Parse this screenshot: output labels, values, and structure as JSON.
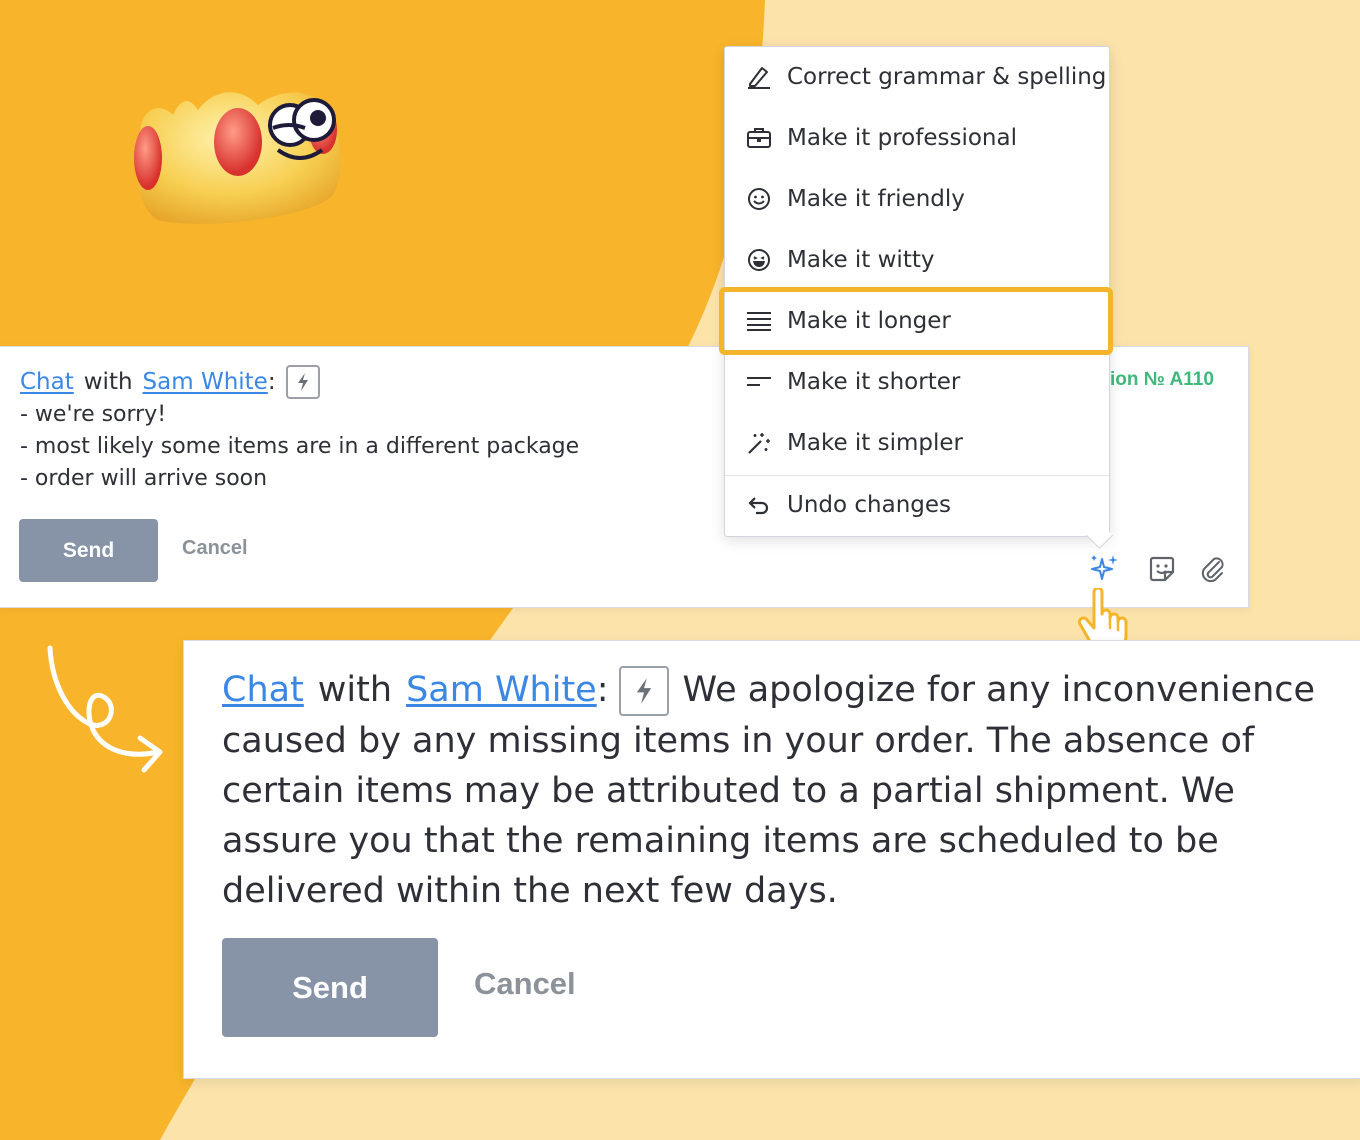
{
  "colors": {
    "background_light": "#fbe3aa",
    "background_orange": "#f8b52b",
    "link": "#3b87e6",
    "send_button": "#8794a8",
    "highlight": "#f5b52a",
    "order_ref": "#3fb97b"
  },
  "small_composer": {
    "chat_link": "Chat",
    "with_text": "with",
    "contact_link": "Sam White",
    "colon": ":",
    "lines": [
      "- we're sorry!",
      "- most likely some items are in a different package",
      "- order will arrive soon"
    ],
    "send_label": "Send",
    "cancel_label": "Cancel",
    "order_ref": "ion № A110",
    "toolbar_icons": [
      "sparkle-icon",
      "sticker-icon",
      "paperclip-icon"
    ]
  },
  "menu": {
    "items": [
      {
        "label": "Correct grammar & spelling",
        "icon": "pencil-icon"
      },
      {
        "label": "Make it professional",
        "icon": "briefcase-icon"
      },
      {
        "label": "Make it friendly",
        "icon": "smile-icon"
      },
      {
        "label": "Make it witty",
        "icon": "grin-icon"
      },
      {
        "label": "Make it longer",
        "icon": "lines-long-icon",
        "selected": true
      },
      {
        "label": "Make it shorter",
        "icon": "lines-short-icon"
      },
      {
        "label": "Make it simpler",
        "icon": "magic-wand-icon"
      },
      {
        "label": "Undo changes",
        "icon": "undo-icon"
      }
    ]
  },
  "large_composer": {
    "chat_link": "Chat",
    "with_text": "with",
    "contact_link": "Sam White",
    "colon": ":",
    "message": "We apologize for any inconvenience caused by any missing items in your order. The absence of certain items may be attributed to a partial shipment. We assure you that the remaining items are scheduled to be delivered within the next few days.",
    "send_label": "Send",
    "cancel_label": "Cancel"
  }
}
